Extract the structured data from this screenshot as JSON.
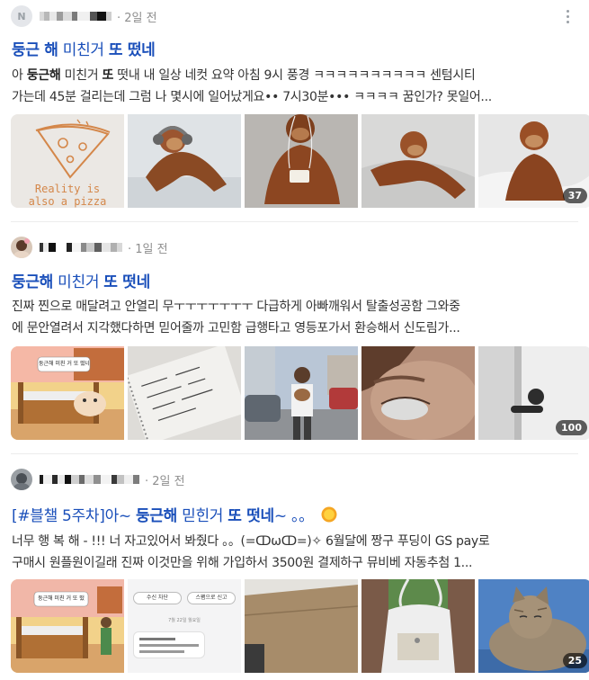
{
  "posts": [
    {
      "time": "· 2일 전",
      "title": {
        "p1": "둥근 해",
        "p2": " 미친거 ",
        "p3": "또 떴네"
      },
      "snippet": {
        "l1a": "아 ",
        "l1b": "둥근해",
        "l1c": " 미친거 ",
        "l1d": "또",
        " l1e": "",
        "l1e": " 떳내 내 일상 네컷 요약 아침 9시 풍경 ㅋㅋㅋㅋㅋㅋㅋㅋㅋㅋ 센텀시티",
        "l2": "가는데 45분 걸리는데 그럼 나 몇시에 일어났게요•• 7시30분••• ㅋㅋㅋㅋ 꿈인가? 못일어..."
      },
      "pizza_text": "Reality is also a pizza",
      "image_count": "37"
    },
    {
      "time": "· 1일 전",
      "title": {
        "p1": "둥근해",
        "p2": " 미친거 ",
        "p3": "또 떳네"
      },
      "snippet": {
        "l1": "진짜 찐으로 매달려고 안열리 무ㅜㅜㅜㅜㅜㅜㅜ 다급하게 아빠깨워서 탈출성공함 그와중",
        "l2": "에 문안열려서 지각했다하면 믿어줄까 고민함 급행타고 영등포가서 환승해서 신도림가..."
      },
      "bubble_text": "둥근해 미친 거 또 떴네",
      "image_count": "100"
    },
    {
      "time": "· 2일 전",
      "title": {
        "p1": "[#블챌 5주차]아~ ",
        "p2": "둥근해",
        "p3": " 믿힌거 ",
        "p4": "또 떳네",
        "p5": "~ 。。"
      },
      "snippet": {
        "l1": "너무 행 복 해 - !!! 너 자고있어서 봐줬다 。。(=ↀωↀ=)✧ 6월달에 짱구 푸딩이 GS pay로",
        "l2": "구매시 원플원이길래 진짜 이것만을 위해 가입하서 3500원 결제하구 뮤비베 자동추첨 1..."
      },
      "bubble_text": "둥근해 미친 거 또 떴",
      "chat_buttons": [
        "수신 차단",
        "스팸으로 신고"
      ],
      "chat_date": "7월 22일 월요일",
      "image_count": "25"
    }
  ],
  "colors": {
    "title": "#1a4fba",
    "meta": "#8e8e8e",
    "badge": "#000000"
  }
}
